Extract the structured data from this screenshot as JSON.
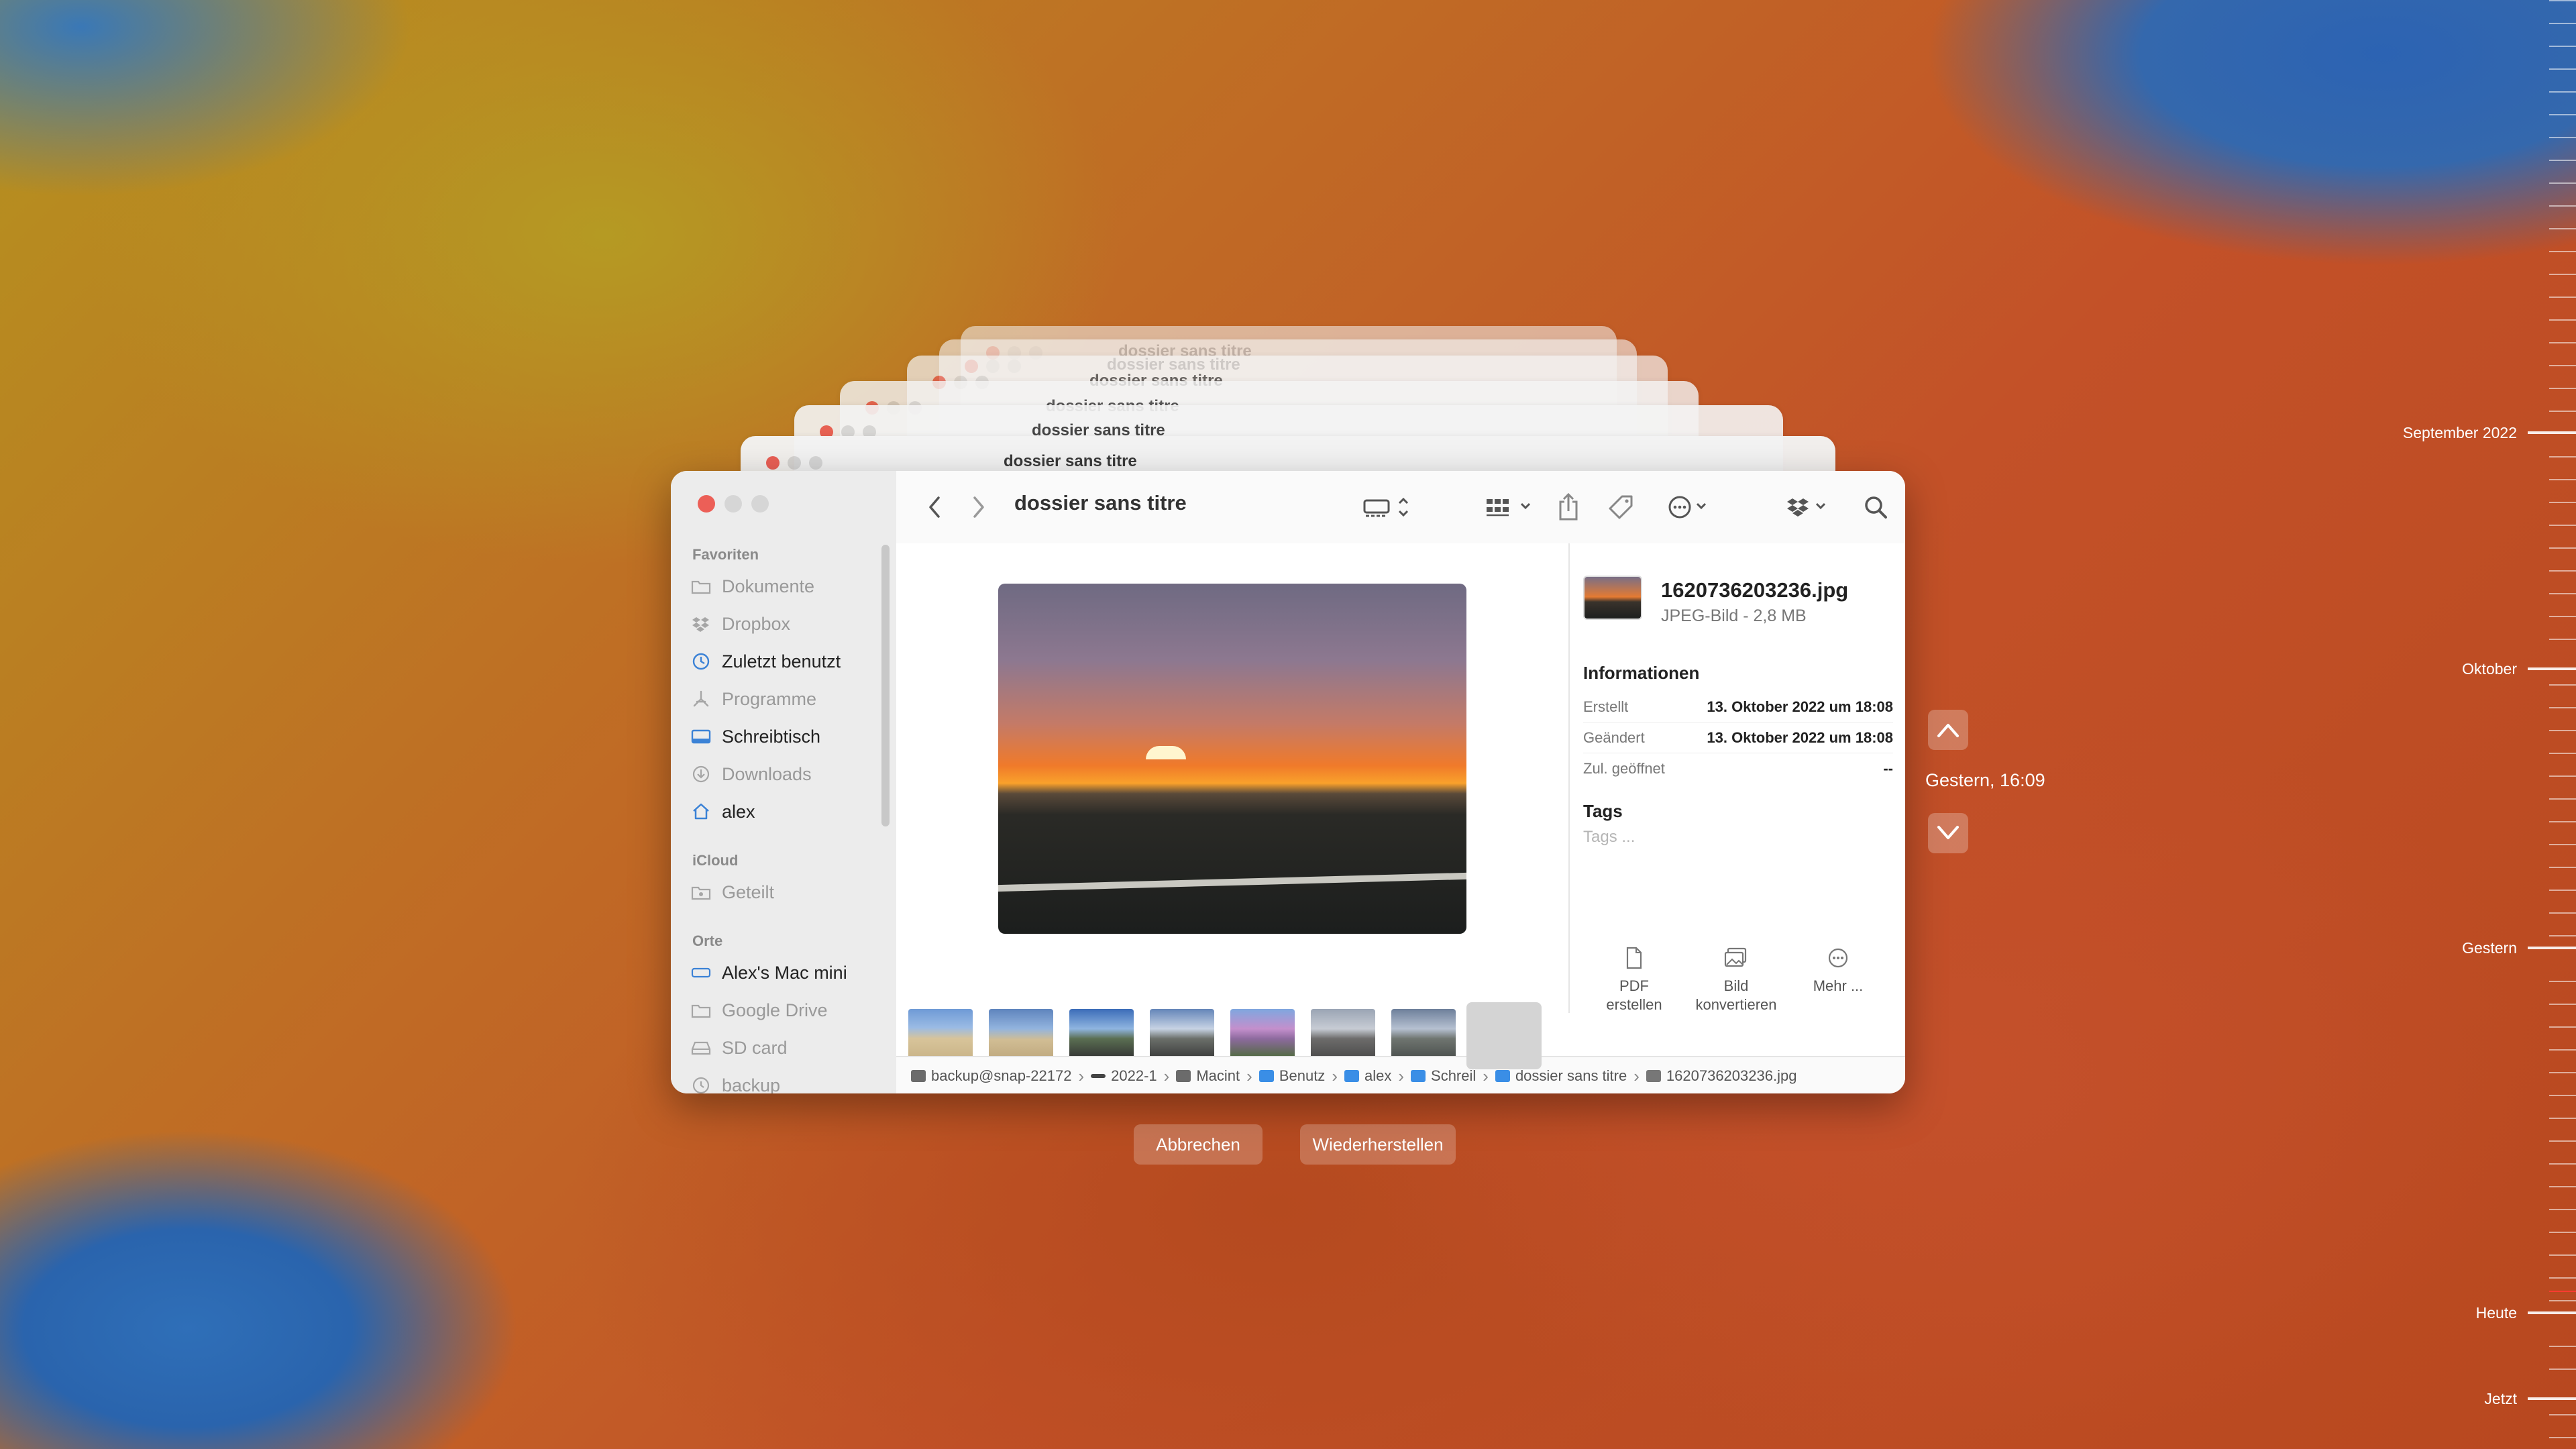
{
  "window": {
    "title": "dossier sans titre",
    "ghost_titles": [
      "dossier sans titre",
      "dossier sans titre",
      "dossier sans titre",
      "dossier sans titre",
      "dossier sans titre",
      "dossier sans titre"
    ]
  },
  "sidebar": {
    "sections": {
      "favorites": "Favoriten",
      "icloud": "iCloud",
      "locations": "Orte"
    },
    "favorites": [
      {
        "label": "Dokumente",
        "icon": "folder-icon",
        "active": false
      },
      {
        "label": "Dropbox",
        "icon": "dropbox-icon",
        "active": false
      },
      {
        "label": "Zuletzt benutzt",
        "icon": "clock-icon",
        "active": true
      },
      {
        "label": "Programme",
        "icon": "apps-icon",
        "active": false
      },
      {
        "label": "Schreibtisch",
        "icon": "desktop-icon",
        "active": true
      },
      {
        "label": "Downloads",
        "icon": "download-icon",
        "active": false
      },
      {
        "label": "alex",
        "icon": "home-icon",
        "active": true
      }
    ],
    "icloud": [
      {
        "label": "Geteilt",
        "icon": "shared-folder-icon",
        "active": false
      }
    ],
    "locations": [
      {
        "label": "Alex's Mac mini",
        "icon": "computer-icon",
        "active": true
      },
      {
        "label": "Google Drive",
        "icon": "folder-icon",
        "active": false
      },
      {
        "label": "SD card",
        "icon": "drive-icon",
        "active": false
      },
      {
        "label": "backup",
        "icon": "timemachine-icon",
        "active": false
      }
    ]
  },
  "file": {
    "name": "1620736203236.jpg",
    "kind_size": "JPEG-Bild - 2,8 MB"
  },
  "inspector": {
    "info_heading": "Informationen",
    "rows": [
      {
        "label": "Erstellt",
        "value": "13. Oktober 2022 um 18:08"
      },
      {
        "label": "Geändert",
        "value": "13. Oktober 2022 um 18:08"
      },
      {
        "label": "Zul. geöffnet",
        "value": "--"
      }
    ],
    "tags_heading": "Tags",
    "tags_placeholder": "Tags ...",
    "actions": [
      {
        "line1": "PDF",
        "line2": "erstellen",
        "icon": "document-icon"
      },
      {
        "line1": "Bild",
        "line2": "konvertieren",
        "icon": "image-convert-icon"
      },
      {
        "line1": "Mehr ...",
        "line2": "",
        "icon": "more-icon"
      }
    ]
  },
  "pathbar": [
    {
      "label": "backup@snap-22172",
      "icon": "drive-icon"
    },
    {
      "label": "2022-1",
      "icon": "bar-icon"
    },
    {
      "label": "Macint",
      "icon": "drive-icon"
    },
    {
      "label": "Benutz",
      "icon": "folder-icon"
    },
    {
      "label": "alex",
      "icon": "home-folder-icon"
    },
    {
      "label": "Schreil",
      "icon": "folder-icon"
    },
    {
      "label": "dossier sans titre",
      "icon": "folder-icon"
    },
    {
      "label": "1620736203236.jpg",
      "icon": "image-file-icon"
    }
  ],
  "timemachine": {
    "current": "Gestern, 16:09",
    "labels": [
      "September 2022",
      "Oktober",
      "Gestern",
      "Heute",
      "Jetzt"
    ],
    "cancel": "Abbrechen",
    "restore": "Wiederherstellen"
  },
  "colors": {
    "accent": "#3b82d6",
    "close": "#ec5f57",
    "inactive_dot": "#d0d0d0"
  }
}
